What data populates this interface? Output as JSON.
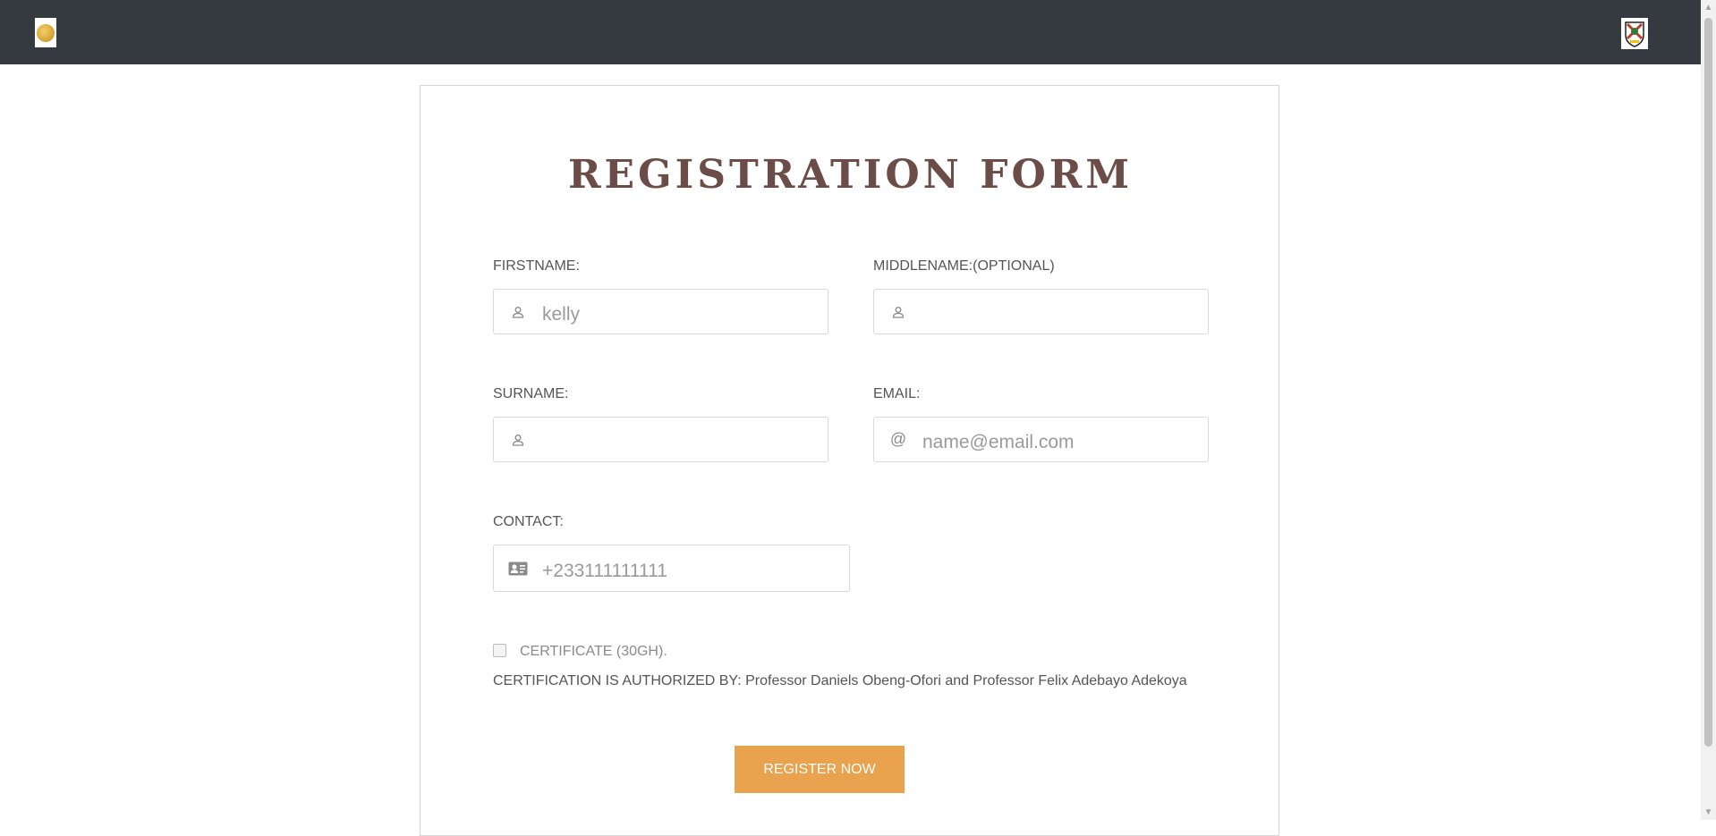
{
  "form": {
    "title": "REGISTRATION FORM",
    "firstname": {
      "label": "FIRSTNAME:",
      "placeholder": "kelly",
      "value": ""
    },
    "middlename": {
      "label": "MIDDLENAME:(OPTIONAL)",
      "placeholder": "",
      "value": ""
    },
    "surname": {
      "label": "SURNAME:",
      "placeholder": "",
      "value": ""
    },
    "email": {
      "label": "EMAIL:",
      "placeholder": "name@email.com",
      "value": ""
    },
    "contact": {
      "label": "CONTACT:",
      "placeholder": "+233111111111",
      "value": ""
    },
    "certificate": {
      "label": "CERTIFICATE (30GH).",
      "checked": false
    },
    "authorization": "CERTIFICATION IS AUTHORIZED BY: Professor Daniels Obeng-Ofori and Professor Felix Adebayo Adekoya",
    "register_label": "REGISTER NOW"
  },
  "icons": {
    "left_logo": "gold-coin-logo",
    "right_logo": "university-crest-logo",
    "name_field": "user-icon",
    "email_field": "at-sign-icon",
    "contact_field": "contact-card-icon"
  },
  "colors": {
    "navbar": "#343a40",
    "title": "#6b4c47",
    "button": "#e9a24e",
    "label": "#555555"
  }
}
